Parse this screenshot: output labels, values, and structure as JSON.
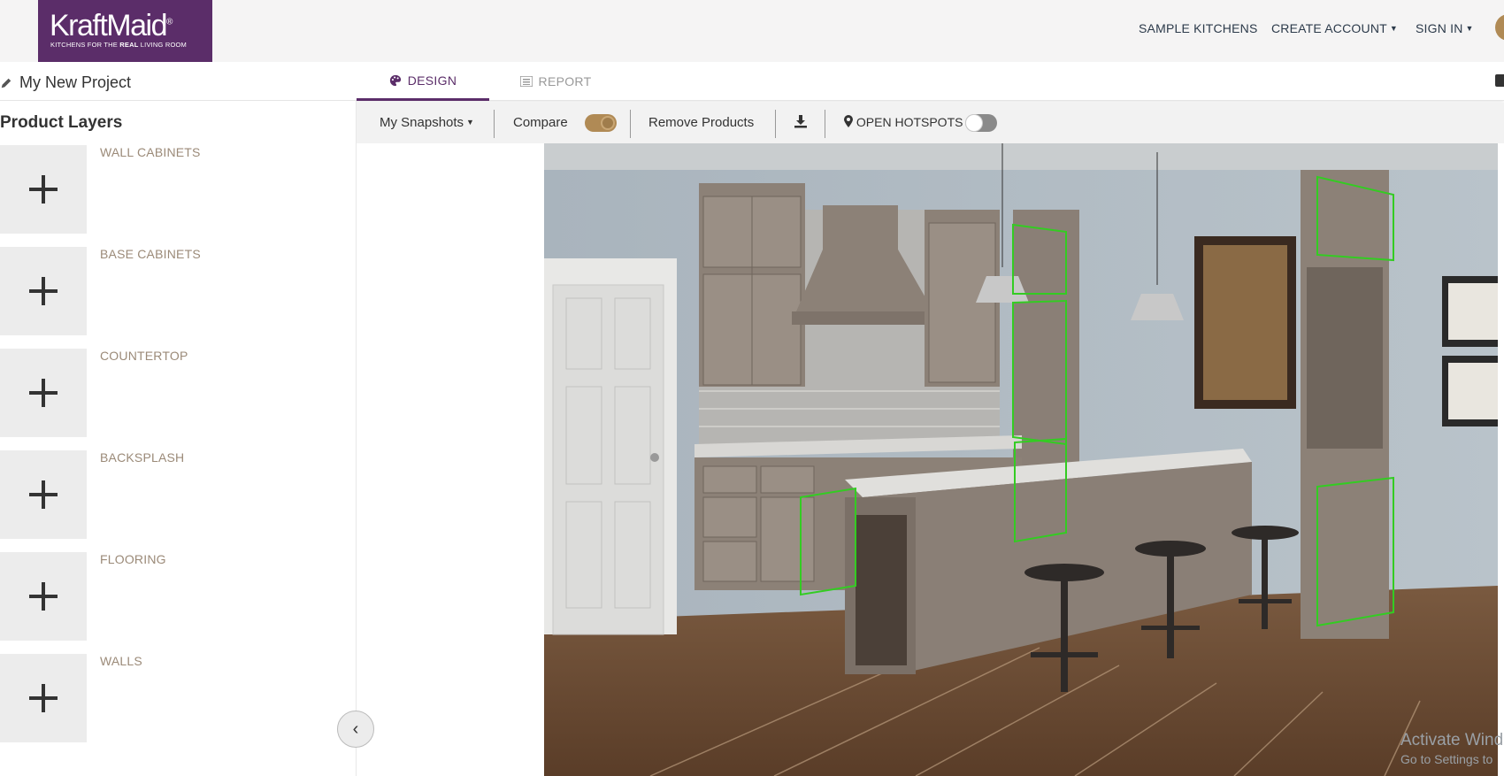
{
  "brand": {
    "wordmark": "KraftMaid",
    "registered": "®",
    "tagline_pre": "KITCHENS FOR THE ",
    "tagline_bold": "REAL",
    "tagline_post": " LIVING ROOM",
    "color": "#5b2d69"
  },
  "topnav": {
    "sample_kitchens": "SAMPLE KITCHENS",
    "create_account": "CREATE ACCOUNT",
    "sign_in": "SIGN IN"
  },
  "project": {
    "name": "My New Project",
    "edit_icon": "pencil-icon"
  },
  "tabs": [
    {
      "label": "DESIGN",
      "icon": "palette-icon",
      "active": true
    },
    {
      "label": "REPORT",
      "icon": "list-icon",
      "active": false
    }
  ],
  "sidebar": {
    "title": "Product Layers",
    "layers": [
      {
        "label": "WALL CABINETS"
      },
      {
        "label": "BASE CABINETS"
      },
      {
        "label": "COUNTERTOP"
      },
      {
        "label": "BACKSPLASH"
      },
      {
        "label": "FLOORING"
      },
      {
        "label": "WALLS"
      }
    ]
  },
  "toolbar": {
    "snapshots": "My Snapshots",
    "compare": "Compare",
    "compare_on": true,
    "remove_products": "Remove Products",
    "download_icon": "download-icon",
    "hotspots": "OPEN HOTSPOTS",
    "hotspots_on": false
  },
  "canvas": {
    "accent_highlight": "#33cc22"
  },
  "watermark": {
    "line1": "Activate Wind",
    "line2": "Go to Settings to"
  }
}
